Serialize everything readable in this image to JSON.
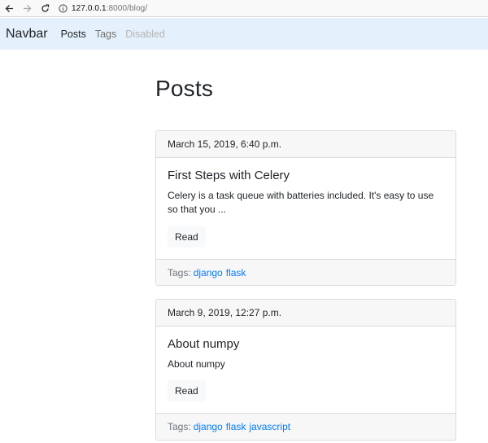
{
  "browser": {
    "url_host": "127.0.0.1",
    "url_path": ":8000/blog/"
  },
  "navbar": {
    "brand": "Navbar",
    "links": [
      {
        "label": "Posts",
        "state": "active"
      },
      {
        "label": "Tags",
        "state": "normal"
      },
      {
        "label": "Disabled",
        "state": "disabled"
      }
    ]
  },
  "main": {
    "title": "Posts",
    "posts": [
      {
        "date": "March 15, 2019, 6:40 p.m.",
        "title": "First Steps with Celery",
        "excerpt": "Celery is a task queue with batteries included. It's easy to use so that you ...",
        "read_label": "Read",
        "tags_label": "Tags:",
        "tags": [
          "django",
          "flask"
        ]
      },
      {
        "date": "March 9, 2019, 12:27 p.m.",
        "title": "About numpy",
        "excerpt": "About numpy",
        "read_label": "Read",
        "tags_label": "Tags:",
        "tags": [
          "django",
          "flask",
          "javascript"
        ]
      }
    ]
  },
  "colors": {
    "navbar_bg": "#e4f0fb",
    "link": "#007bff"
  }
}
